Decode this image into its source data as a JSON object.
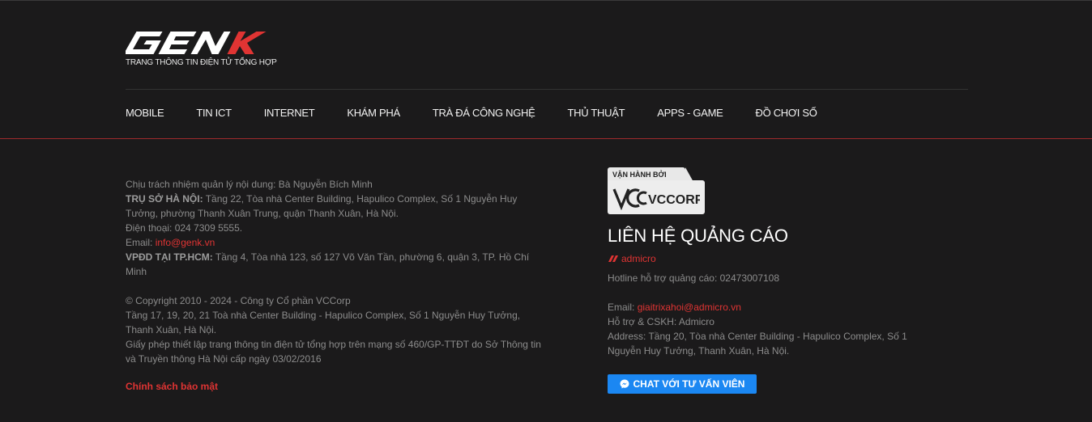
{
  "brand": {
    "logo_text": "GENK",
    "tagline": "TRANG THÔNG TIN ĐIỆN TỬ TỔNG HỢP"
  },
  "nav": {
    "items": [
      {
        "label": "MOBILE"
      },
      {
        "label": "TIN ICT"
      },
      {
        "label": "INTERNET"
      },
      {
        "label": "KHÁM PHÁ"
      },
      {
        "label": "TRÀ ĐÁ CÔNG NGHỆ"
      },
      {
        "label": "THỦ THUẬT"
      },
      {
        "label": "APPS - GAME"
      },
      {
        "label": "ĐỒ CHƠI SỐ"
      }
    ]
  },
  "footer_left": {
    "content_manager": "Chịu trách nhiệm quản lý nội dung: Bà Nguyễn Bích Minh",
    "hanoi_label": "TRỤ SỞ HÀ NỘI:",
    "hanoi_address": " Tầng 22, Tòa nhà Center Building, Hapulico Complex, Số 1 Nguyễn Huy Tưởng, phường Thanh Xuân Trung, quận Thanh Xuân, Hà Nội.",
    "phone": "Điện thoại: 024 7309 5555.",
    "email_label": "Email: ",
    "email_value": "info@genk.vn",
    "hcm_label": "VPĐD TẠI TP.HCM:",
    "hcm_address": " Tầng 4, Tòa nhà 123, số 127 Võ Văn Tần, phường 6, quận 3, TP. Hồ Chí Minh",
    "copyright": "© Copyright 2010 - 2024 - Công ty Cổ phần VCCorp",
    "vccorp_address": "Tầng 17, 19, 20, 21 Toà nhà Center Building - Hapulico Complex, Số 1 Nguyễn Huy Tưởng, Thanh Xuân, Hà Nội.",
    "license": "Giấy phép thiết lập trang thông tin điện tử tổng hợp trên mạng số 460/GP-TTĐT do Sở Thông tin và Truyền thông Hà Nội cấp ngày 03/02/2016",
    "privacy_link": "Chính sách bảo mật"
  },
  "footer_right": {
    "operated_by": "VẬN HÀNH BỞI",
    "operator_logo_text": "VCCORP",
    "contact_title": "LIÊN HỆ QUẢNG CÁO",
    "admicro_label": "admicro",
    "hotline": "Hotline hỗ trợ quảng cáo: 02473007108",
    "email_label": "Email: ",
    "email_value": "giaitrixahoi@admicro.vn",
    "support": "Hỗ trợ & CSKH: Admicro",
    "address": "Address: Tầng 20, Tòa nhà Center Building - Hapulico Complex, Số 1 Nguyễn Huy Tưởng, Thanh Xuân, Hà Nội.",
    "chat_button": "CHAT VỚI TƯ VẤN VIÊN"
  },
  "colors": {
    "background": "#1b1a1b",
    "accent_red": "#e03433",
    "chat_blue": "#1b87f2"
  }
}
